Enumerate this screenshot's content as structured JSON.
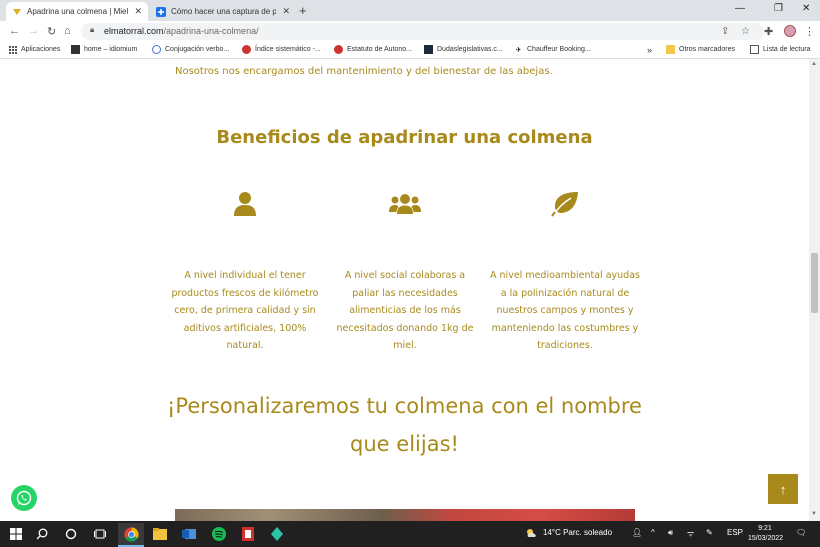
{
  "browser": {
    "tabs": [
      {
        "title": "Apadrina una colmena | Miel de M",
        "close": "✕"
      },
      {
        "title": "Cómo hacer una captura de pant",
        "close": "✕"
      }
    ],
    "new_tab": "+",
    "window_controls": {
      "minimize": "—",
      "restore": "❐",
      "close": "✕"
    },
    "url_domain": "elmatorral.com",
    "url_path": "/apadrina-una-colmena/",
    "bookmarks": [
      {
        "label": "Aplicaciones",
        "icon": "apps-grid-icon"
      },
      {
        "label": "home – idiomium",
        "icon": "site-icon"
      },
      {
        "label": "Conjugación verbo...",
        "icon": "site-icon"
      },
      {
        "label": "Índice sistemático -...",
        "icon": "site-icon"
      },
      {
        "label": "Estatuto de Autono...",
        "icon": "site-icon"
      },
      {
        "label": "Dudaslegislativas.c...",
        "icon": "site-icon"
      },
      {
        "label": "Chauffeur Booking...",
        "icon": "site-icon"
      }
    ],
    "bookmarks_more": "»",
    "other_bookmarks": "Otros marcadores",
    "reading_list": "Lista de lectura"
  },
  "page": {
    "intro": "Nosotros nos encargamos del mantenimiento y del bienestar de las abejas.",
    "benefits_title": "Beneficios de apadrinar una colmena",
    "benefits": [
      {
        "icon": "user-icon",
        "text": "A nivel individual el tener productos frescos de kilómetro cero, de primera calidad y sin aditivos artificiales, 100% natural."
      },
      {
        "icon": "users-icon",
        "text": "A nivel social colaboras a paliar las necesidades alimenticias de los más necesitados donando 1kg de miel."
      },
      {
        "icon": "leaf-icon",
        "text": "A nivel medioambiental ayudas a la polinización natural de nuestros campos y montes y manteniendo las costumbres y tradiciones."
      }
    ],
    "personalize_line1": "¡Personalizaremos tu colmena con el nombre",
    "personalize_line2": "que elijas!",
    "to_top": "↑",
    "accent_color": "#a88a1c"
  },
  "taskbar": {
    "weather": "14°C  Parc. soleado",
    "language": "ESP",
    "time": "9:21",
    "date": "15/03/2022"
  }
}
